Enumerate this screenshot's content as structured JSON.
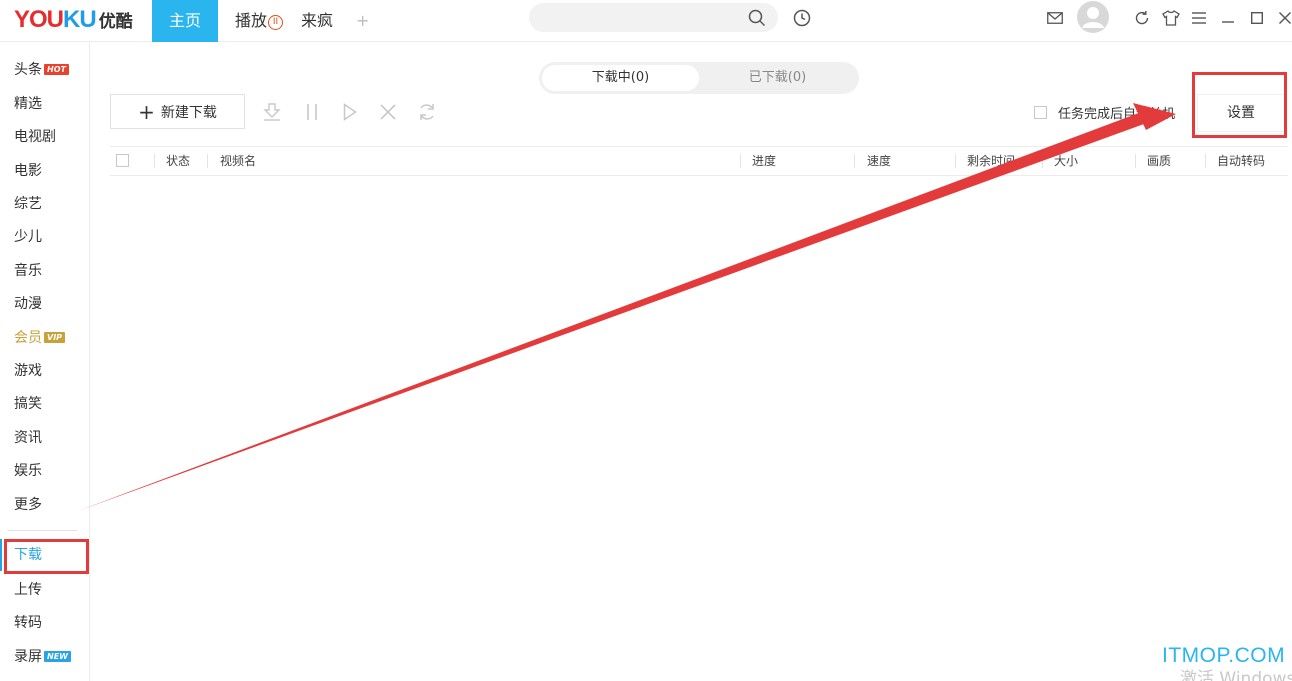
{
  "logo": {
    "en_part1": "YOU",
    "en_part2": "KU",
    "cn": "优酷"
  },
  "tabs": {
    "home": "主页",
    "play": "播放",
    "play_badge": "II",
    "laifeng": "来疯",
    "add": "+"
  },
  "search": {
    "placeholder": ""
  },
  "sidebar": {
    "items": [
      {
        "label": "头条",
        "tag": "HOT"
      },
      {
        "label": "精选"
      },
      {
        "label": "电视剧"
      },
      {
        "label": "电影"
      },
      {
        "label": "综艺"
      },
      {
        "label": "少儿"
      },
      {
        "label": "音乐"
      },
      {
        "label": "动漫"
      },
      {
        "label": "会员",
        "tag": "VIP"
      },
      {
        "label": "游戏"
      },
      {
        "label": "搞笑"
      },
      {
        "label": "资讯"
      },
      {
        "label": "娱乐"
      },
      {
        "label": "更多"
      },
      {
        "label": "下载"
      },
      {
        "label": "上传"
      },
      {
        "label": "转码"
      },
      {
        "label": "录屏",
        "tag": "NEW"
      }
    ]
  },
  "download": {
    "tab_downloading": "下载中(0)",
    "tab_downloaded": "已下载(0)",
    "new_button": "新建下载",
    "new_button_plus": "+",
    "auto_shutdown": "任务完成后自动关机",
    "settings": "设置",
    "columns": [
      "状态",
      "视频名",
      "进度",
      "速度",
      "剩余时间",
      "大小",
      "画质",
      "自动转码"
    ]
  },
  "watermark": "ITMOP.COM",
  "activate_text": "激活 Windows",
  "colors": {
    "accent": "#2bb5ee",
    "annotation": "#e33b3b",
    "vip": "#c9a13a",
    "hot": "#e8412c"
  }
}
